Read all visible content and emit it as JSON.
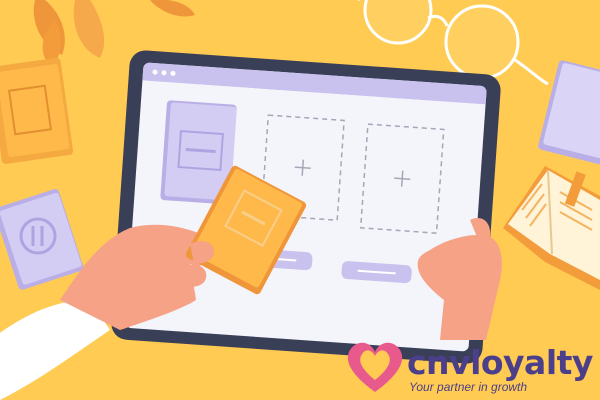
{
  "logo": {
    "brand": "cnvloyalty",
    "tagline": "Your partner in growth"
  },
  "icons": [
    "heart-logo-icon",
    "plus-icon",
    "glasses-icon",
    "leaf-icon",
    "book-icon"
  ],
  "colors": {
    "background": "#FFCB52",
    "accent": "#F0963A",
    "brand": "#4B3F8C",
    "heart": "#E85A8C",
    "tablet_frame": "#3A3F58",
    "screen": "#F4F4FB",
    "lavender": "#C9C2EE"
  }
}
